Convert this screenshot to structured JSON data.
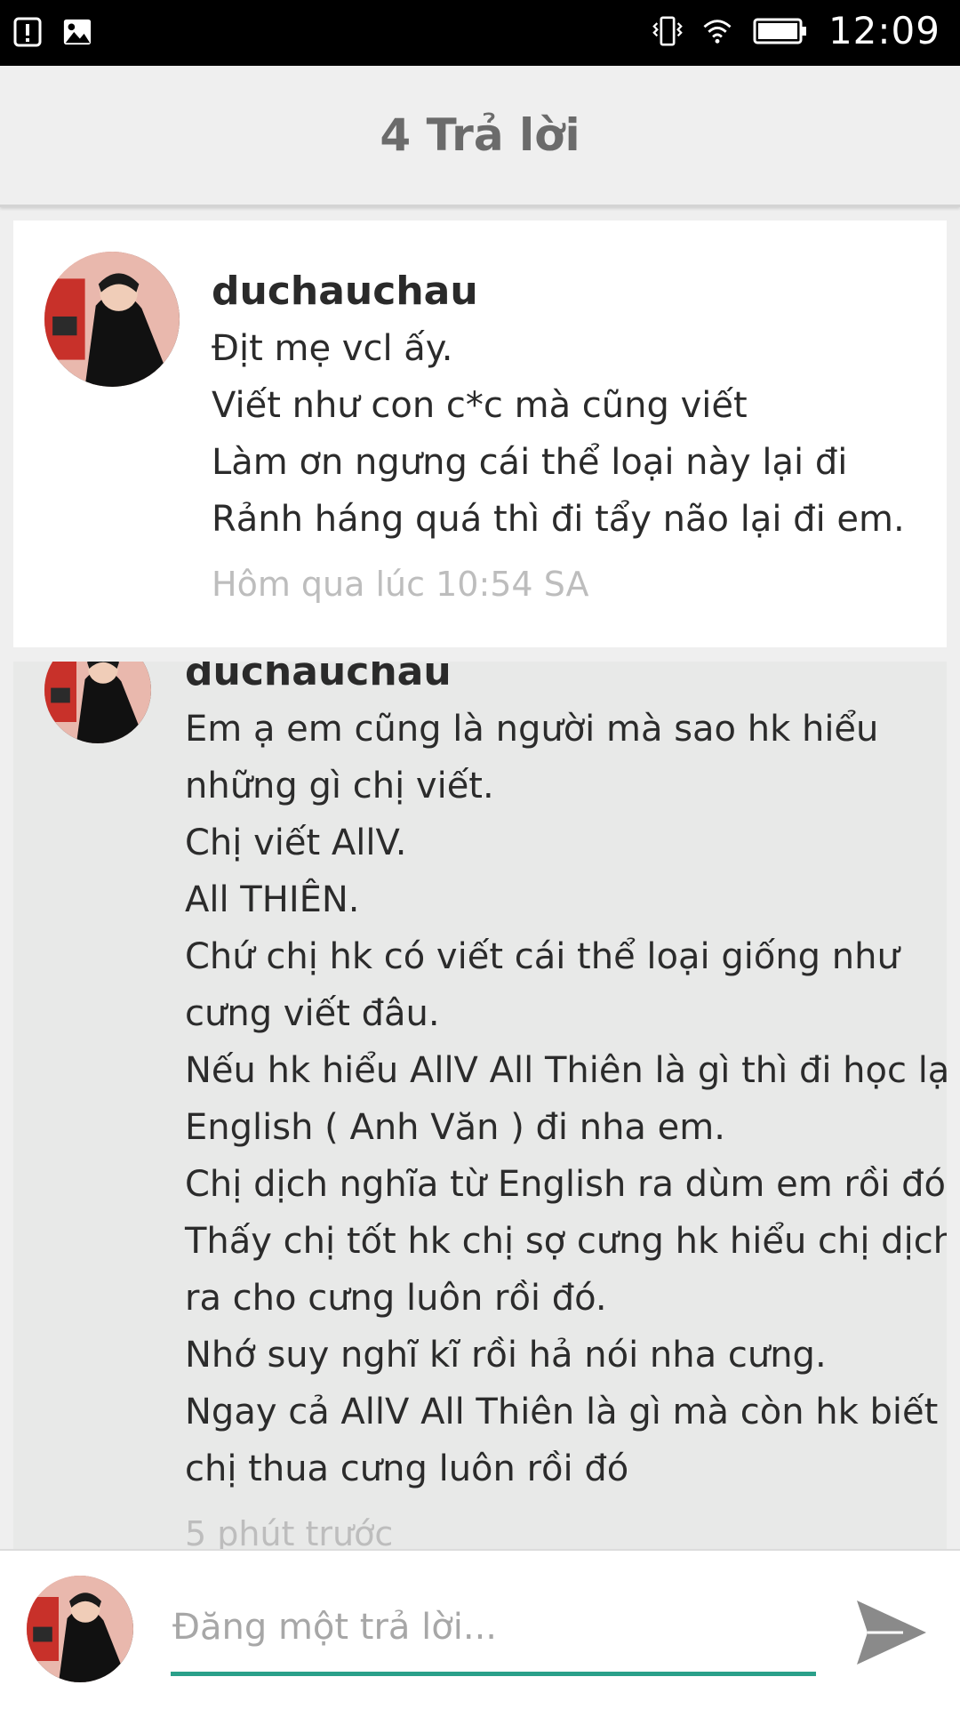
{
  "status_bar": {
    "time": "12:09"
  },
  "header": {
    "title": "4 Trả lời"
  },
  "comments": [
    {
      "username": "duchauchau",
      "lines": [
        "Địt mẹ vcl ấy.",
        "Viết như con c*c mà cũng viết",
        "Làm ơn ngưng cái thể loại này lại đi",
        "Rảnh háng quá thì đi tẩy não lại đi em."
      ],
      "timestamp": "Hôm qua lúc 10:54 SA"
    },
    {
      "username": "duchauchau",
      "lines": [
        "Em ạ em cũng là người mà sao hk hiểu",
        "những gì chị viết.",
        "Chị viết AllV.",
        "All THIÊN.",
        "Chứ chị hk có viết cái thể loại giống như",
        "cưng viết đâu.",
        "Nếu hk hiểu AllV All Thiên là gì thì đi học lại",
        "English ( Anh Văn ) đi nha em.",
        "Chị dịch nghĩa từ English ra dùm em rồi đó.",
        "Thấy chị tốt hk chị sợ cưng hk hiểu chị dịch",
        "ra cho cưng luôn rồi đó.",
        "Nhớ suy nghĩ kĩ rồi hả nói nha cưng.",
        "Ngay cả AllV All Thiên là gì mà còn hk biết là",
        "chị thua cưng luôn rồi đó"
      ],
      "timestamp": "5 phút trước"
    }
  ],
  "reply": {
    "placeholder": "Đăng một trả lời..."
  },
  "colors": {
    "accent": "#2aa08a",
    "header_bg": "#efefef",
    "card_grey": "#e8e9e8"
  },
  "icons": {
    "status_left": [
      "alert-icon",
      "image-icon"
    ],
    "status_right": [
      "vibrate-icon",
      "wifi-icon",
      "battery-icon"
    ],
    "send": "send-icon"
  }
}
